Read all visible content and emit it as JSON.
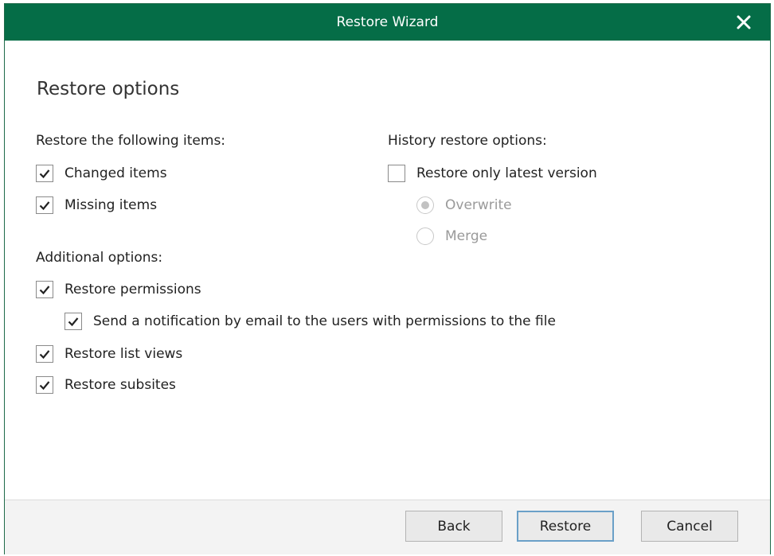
{
  "window": {
    "title": "Restore Wizard",
    "close_icon": "close-icon",
    "accent_color": "#056d47"
  },
  "page": {
    "heading": "Restore options"
  },
  "restore_items": {
    "label": "Restore the following items:",
    "options": [
      {
        "label": "Changed items",
        "checked": true
      },
      {
        "label": "Missing items",
        "checked": true
      }
    ]
  },
  "history": {
    "label": "History restore options:",
    "latest_version": {
      "label": "Restore only latest version",
      "checked": false
    },
    "radios": [
      {
        "label": "Overwrite",
        "selected": true,
        "enabled": false
      },
      {
        "label": "Merge",
        "selected": false,
        "enabled": false
      }
    ]
  },
  "additional": {
    "label": "Additional options:",
    "permissions": {
      "label": "Restore permissions",
      "checked": true
    },
    "notify": {
      "label": "Send a notification by email to the users with permissions to the file",
      "checked": true
    },
    "list_views": {
      "label": "Restore list views",
      "checked": true
    },
    "subsites": {
      "label": "Restore subsites",
      "checked": true
    }
  },
  "buttons": {
    "back": "Back",
    "restore": "Restore",
    "cancel": "Cancel"
  }
}
